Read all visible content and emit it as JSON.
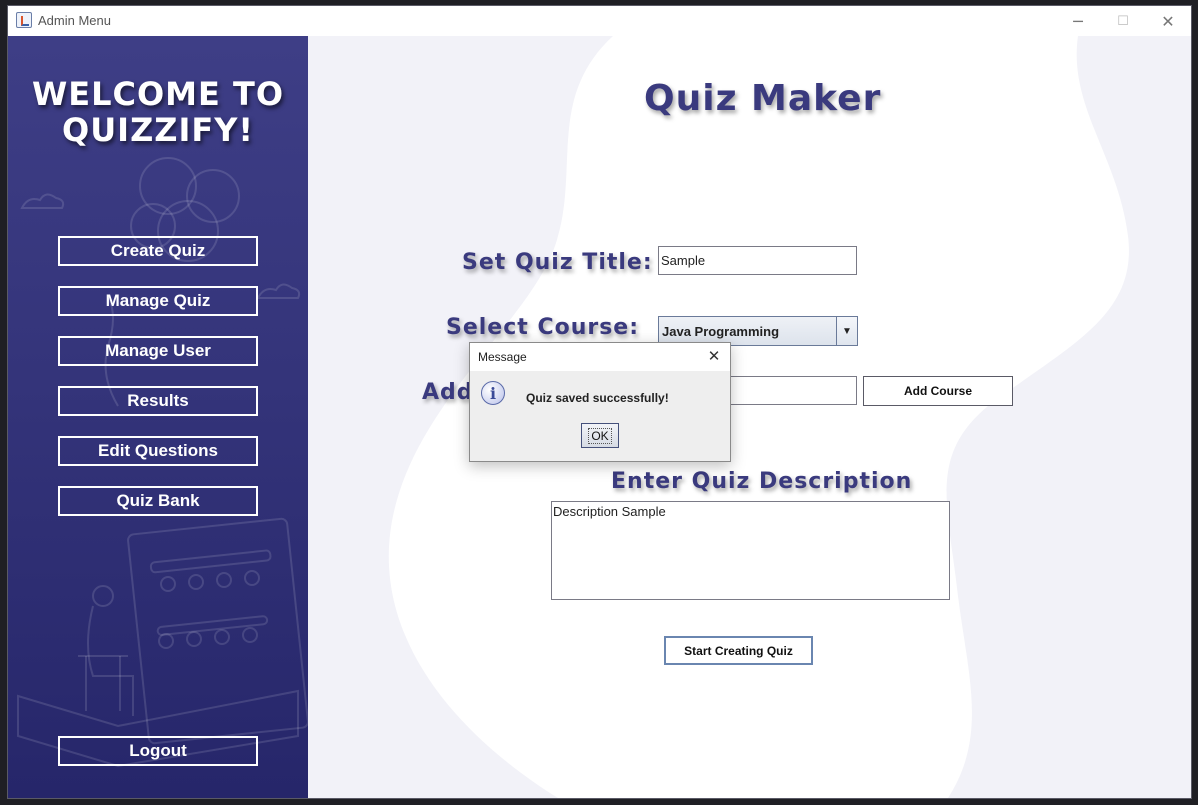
{
  "window": {
    "title": "Admin Menu",
    "minimize_glyph": "─",
    "maximize_glyph": "☐",
    "close_glyph": "✕"
  },
  "sidebar": {
    "welcome_line1": "WELCOME TO",
    "welcome_line2": "QUIZZIFY!",
    "items": [
      {
        "label": "Create Quiz"
      },
      {
        "label": "Manage Quiz"
      },
      {
        "label": "Manage User"
      },
      {
        "label": "Results"
      },
      {
        "label": "Edit Questions"
      },
      {
        "label": "Quiz Bank"
      }
    ],
    "logout_label": "Logout"
  },
  "main": {
    "page_title": "Quiz Maker",
    "set_title_label": "Set Quiz Title:",
    "quiz_title_value": "Sample",
    "select_course_label": "Select Course:",
    "selected_course": "Java Programming",
    "add_course_label": "Add",
    "course_input_value": "",
    "add_course_button": "Add Course",
    "description_label": "Enter Quiz Description",
    "description_value": "Description Sample",
    "start_button": "Start Creating Quiz"
  },
  "dialog": {
    "title": "Message",
    "close_glyph": "✕",
    "icon_glyph": "i",
    "message": "Quiz saved successfully!",
    "ok_label": "OK"
  },
  "colors": {
    "sidebar_top": "#3e3e86",
    "sidebar_bottom": "#26266a",
    "heading": "#3a3a7e",
    "main_background": "#f2f2f8"
  }
}
